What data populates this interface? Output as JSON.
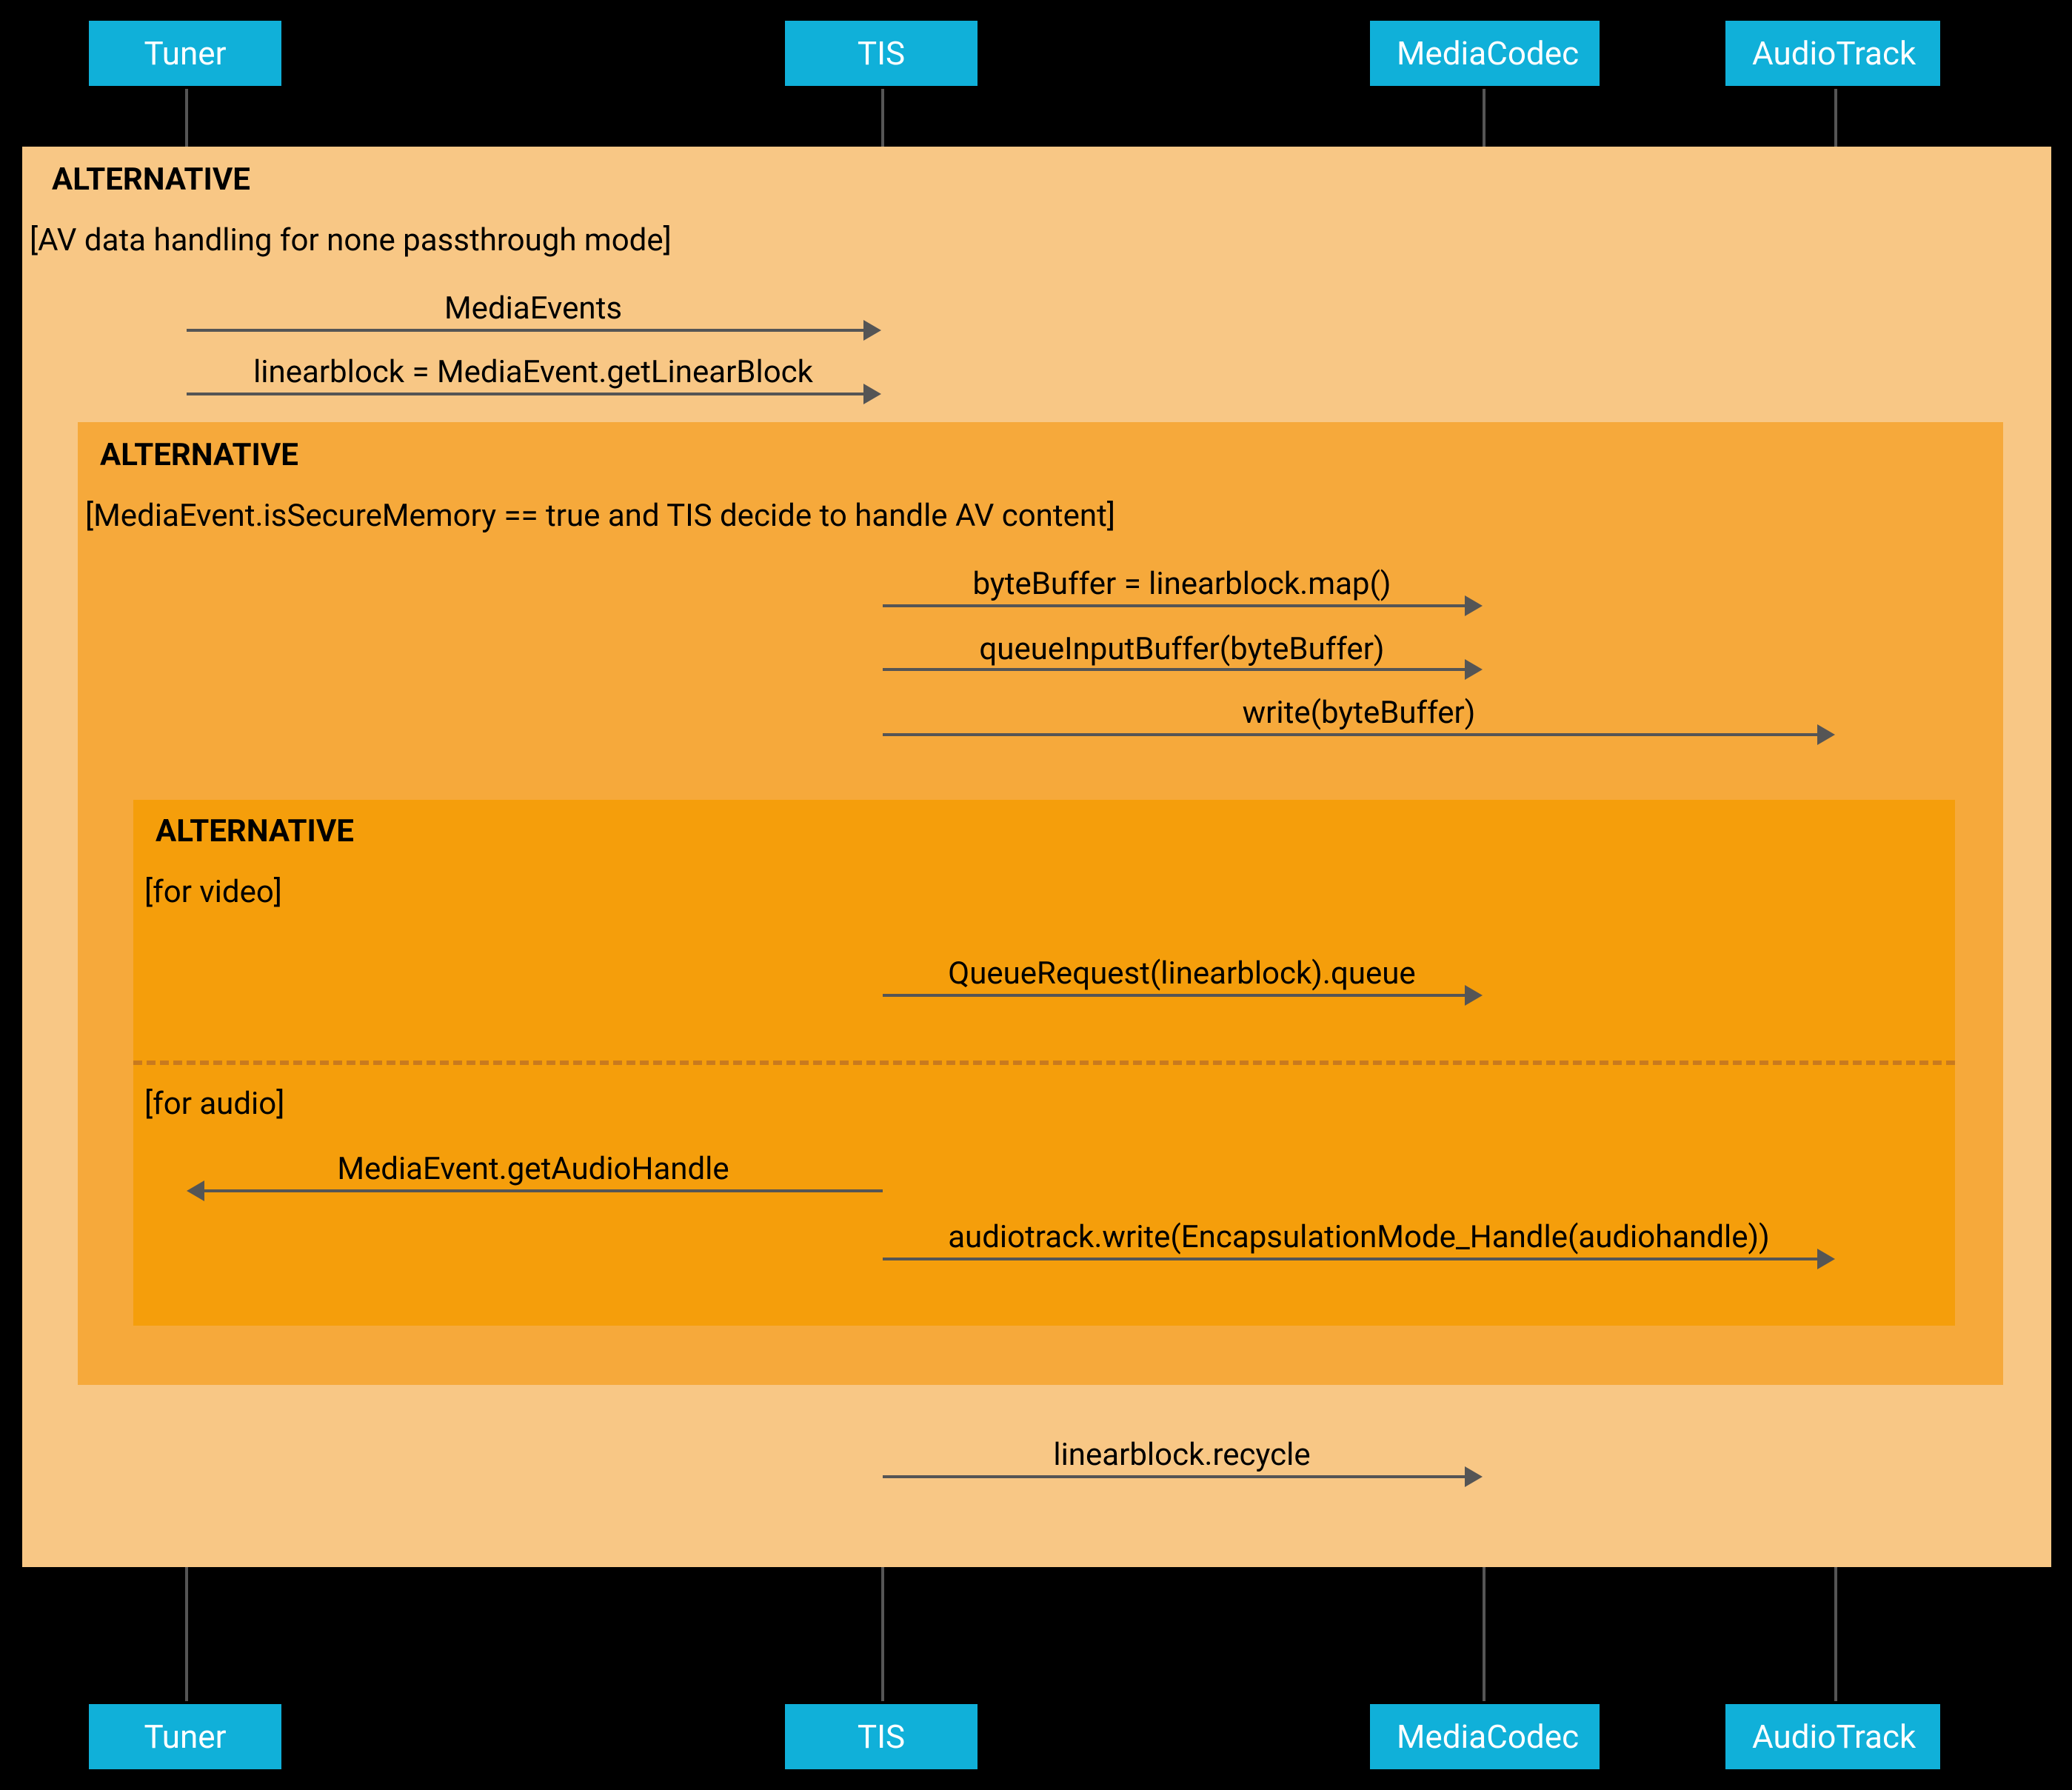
{
  "actors": {
    "tuner": "Tuner",
    "tis": "TIS",
    "mediacodec": "MediaCodec",
    "audiotrack": "AudioTrack"
  },
  "alt_labels": {
    "outer": "ALTERNATIVE",
    "middle": "ALTERNATIVE",
    "inner": "ALTERNATIVE"
  },
  "conditions": {
    "outer": "[AV data handling for none passthrough mode]",
    "middle": "[MediaEvent.isSecureMemory == true and TIS decide to handle AV content]",
    "video": "[for video]",
    "audio": "[for audio]"
  },
  "messages": {
    "m1": "MediaEvents",
    "m2": "linearblock = MediaEvent.getLinearBlock",
    "m3": "byteBuffer = linearblock.map()",
    "m4": "queueInputBuffer(byteBuffer)",
    "m5": "write(byteBuffer)",
    "m6": "QueueRequest(linearblock).queue",
    "m7": "MediaEvent.getAudioHandle",
    "m8": "audiotrack.write(EncapsulationMode_Handle(audiohandle))",
    "m9": "linearblock.recycle"
  },
  "chart_data": {
    "type": "sequence-diagram",
    "participants": [
      "Tuner",
      "TIS",
      "MediaCodec",
      "AudioTrack"
    ],
    "fragments": [
      {
        "type": "alt",
        "label": "ALTERNATIVE",
        "guards": [
          "AV data handling for none passthrough mode"
        ],
        "contents": [
          {
            "from": "Tuner",
            "to": "TIS",
            "label": "MediaEvents"
          },
          {
            "from": "Tuner",
            "to": "TIS",
            "label": "linearblock = MediaEvent.getLinearBlock"
          },
          {
            "type": "alt",
            "label": "ALTERNATIVE",
            "guards": [
              "MediaEvent.isSecureMemory == true and TIS decide to handle AV content"
            ],
            "contents": [
              {
                "from": "TIS",
                "to": "MediaCodec",
                "label": "byteBuffer = linearblock.map()"
              },
              {
                "from": "TIS",
                "to": "MediaCodec",
                "label": "queueInputBuffer(byteBuffer)"
              },
              {
                "from": "TIS",
                "to": "AudioTrack",
                "label": "write(byteBuffer)"
              },
              {
                "type": "alt",
                "label": "ALTERNATIVE",
                "guards": [
                  "for video",
                  "for audio"
                ],
                "regions": [
                  [
                    {
                      "from": "TIS",
                      "to": "MediaCodec",
                      "label": "QueueRequest(linearblock).queue"
                    }
                  ],
                  [
                    {
                      "from": "TIS",
                      "to": "Tuner",
                      "label": "MediaEvent.getAudioHandle"
                    },
                    {
                      "from": "TIS",
                      "to": "AudioTrack",
                      "label": "audiotrack.write(EncapsulationMode_Handle(audiohandle))"
                    }
                  ]
                ]
              }
            ]
          },
          {
            "from": "TIS",
            "to": "MediaCodec",
            "label": "linearblock.recycle"
          }
        ]
      }
    ]
  }
}
